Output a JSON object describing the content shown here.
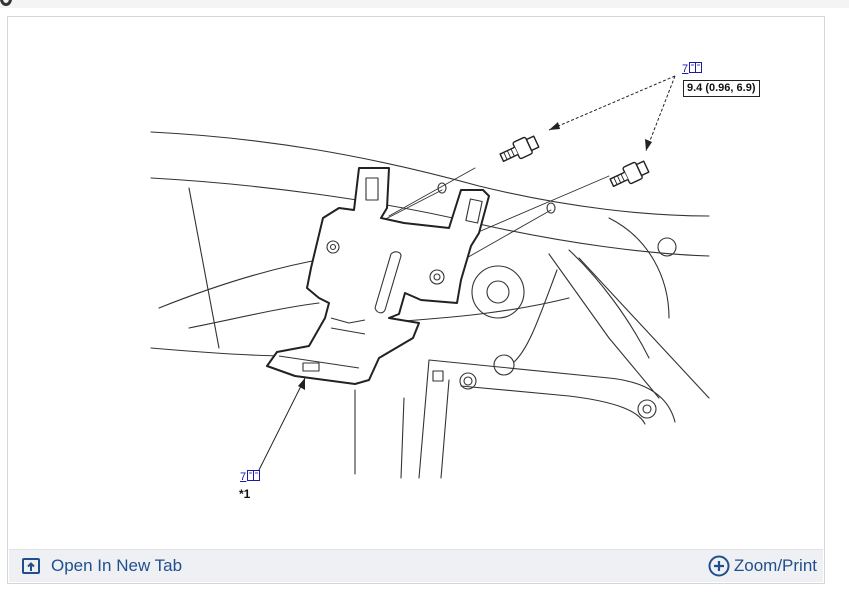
{
  "top_callout": {
    "link_text": "7",
    "torque_spec": "9.4 (0.96, 6.9)"
  },
  "bottom_callout": {
    "link_text": "7",
    "note": "*1"
  },
  "toolbar": {
    "open_label": "Open In New Tab",
    "zoom_label": "Zoom/Print",
    "open_icon": "open-in-new-tab-icon",
    "zoom_icon": "plus-circle-icon",
    "accent_color": "#1f4f8f"
  },
  "icons": {
    "callout_icon": "manual-book-icon"
  }
}
